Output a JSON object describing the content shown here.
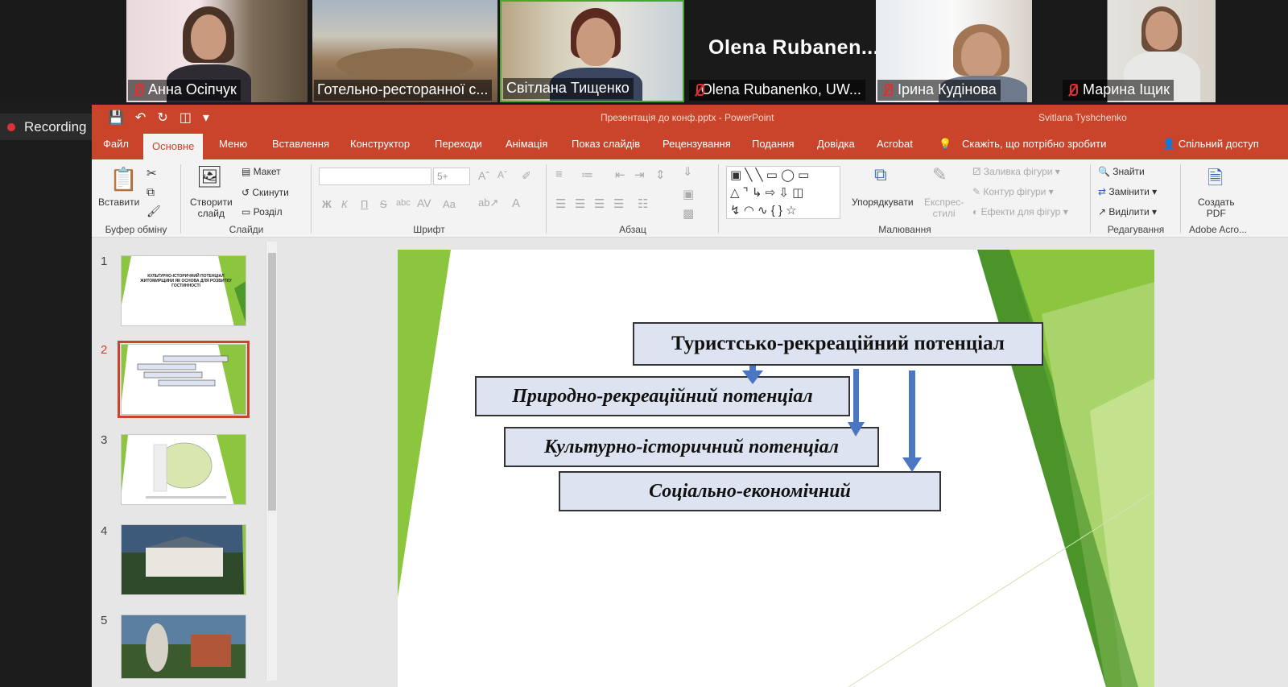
{
  "participants": [
    {
      "name": "Анна Осіпчук"
    },
    {
      "name": "Готельно-ресторанної с..."
    },
    {
      "name": "Світлана Тищенко"
    },
    {
      "name": "Olena Rubanenko, UW..."
    },
    {
      "name": "Ірина Кудінова"
    },
    {
      "name": "Марина Іщик"
    }
  ],
  "speaker_big_name": "Olena  Rubanen...",
  "recording": {
    "label": "Recording",
    "color": "#e0303a"
  },
  "app": {
    "title": "Презентація до конф.pptx  -  PowerPoint",
    "user": "Svitlana Tyshchenko",
    "accent": "#c9442a"
  },
  "tabs": [
    "Файл",
    "Основне",
    "Меню",
    "Вставлення",
    "Конструктор",
    "Переходи",
    "Анімація",
    "Показ слайдів",
    "Рецензування",
    "Подання",
    "Довідка",
    "Acrobat",
    "Скажіть, що потрібно зробити",
    "Спільний доступ"
  ],
  "ribbon": {
    "clipboard": {
      "paste": "Вставити",
      "label": "Буфер обміну"
    },
    "slides": {
      "new_slide": "Створити",
      "new_slide2": "слайд",
      "layout": "Макет",
      "reset": "Скинути",
      "section": "Розділ",
      "label": "Слайди"
    },
    "font": {
      "size": "5+",
      "bold": "Ж",
      "italic": "К",
      "underline": "П",
      "strike": "S",
      "aa": "Aa",
      "label": "Шрифт"
    },
    "paragraph": {
      "label": "Абзац"
    },
    "drawing": {
      "arrange": "Упорядкувати",
      "styles": "Експрес-",
      "styles2": "стилі",
      "fill": "Заливка фігури",
      "outline": "Контур фігури",
      "effects": "Ефекти для фігур",
      "label": "Малювання"
    },
    "editing": {
      "find": "Знайти",
      "replace": "Замінити",
      "select": "Виділити",
      "label": "Редагування"
    },
    "adobe": {
      "create": "Создать",
      "pdf": "PDF",
      "label": "Adobe Acro..."
    }
  },
  "thumbnails": [
    {
      "num": "1"
    },
    {
      "num": "2"
    },
    {
      "num": "3"
    },
    {
      "num": "4"
    },
    {
      "num": "5"
    }
  ],
  "thumb1_text": "КУЛЬТУРНО-ІСТОРИЧНИЙ ПОТЕНЦІАЛ ЖИТОМИРЩИНИ ЯК ОСНОВА ДЛЯ РОЗВИТКУ ГОСТИННОСТІ",
  "slide": {
    "boxes": [
      "Туристсько-рекреаційний потенціал",
      "Природно-рекреаційний потенціал",
      "Культурно-історичний потенціал",
      "Соціально-економічний"
    ]
  }
}
